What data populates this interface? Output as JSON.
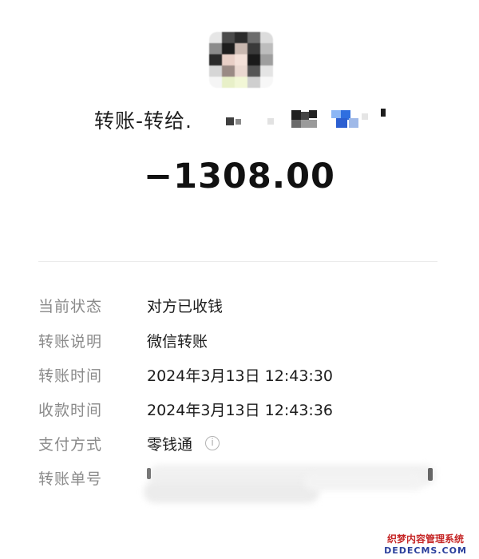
{
  "header": {
    "title_prefix": "转账-转给.",
    "amount": "−1308.00"
  },
  "details": [
    {
      "label": "当前状态",
      "value": "对方已收钱"
    },
    {
      "label": "转账说明",
      "value": "微信转账"
    },
    {
      "label": "转账时间",
      "value": "2024年3月13日 12:43:30"
    },
    {
      "label": "收款时间",
      "value": "2024年3月13日 12:43:36"
    },
    {
      "label": "支付方式",
      "value": "零钱通",
      "icon": "info-icon"
    },
    {
      "label": "转账单号",
      "value": ""
    }
  ],
  "watermark": {
    "line1": "织梦内容管理系统",
    "line2": "DEDECMS.COM"
  },
  "colors": {
    "label": "#8a8a8a",
    "value": "#1c1c1c",
    "divider": "#ebebeb",
    "watermark_red": "#c62828",
    "watermark_blue": "#2a3f9c"
  }
}
